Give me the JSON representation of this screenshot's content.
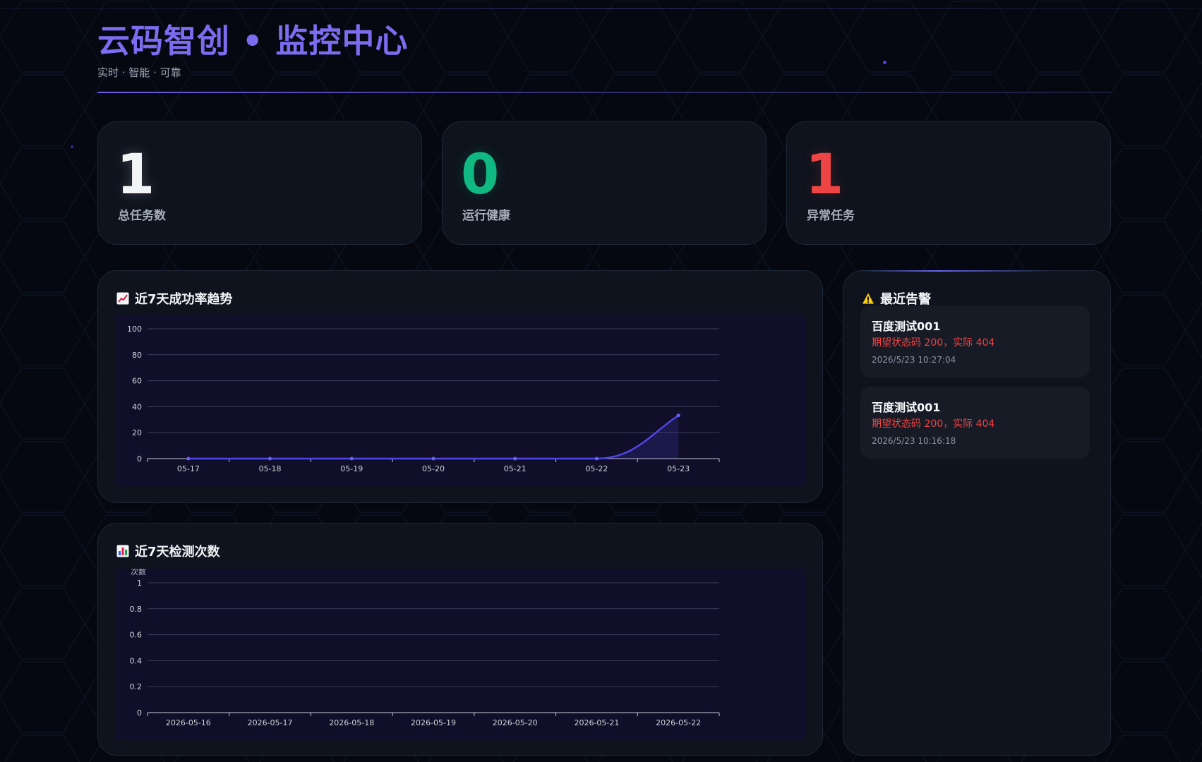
{
  "header": {
    "title": "云码智创 • 监控中心",
    "subtitle": "实时 · 智能 · 可靠"
  },
  "stats": [
    {
      "value": "1",
      "label": "总任务数",
      "color": "#f3f4f6"
    },
    {
      "value": "0",
      "label": "运行健康",
      "color": "#10b981"
    },
    {
      "value": "1",
      "label": "异常任务",
      "color": "#ef4444"
    }
  ],
  "panels": {
    "trend_title": "近7天成功率趋势",
    "trend_icon": "chart-increasing-icon",
    "count_title": "近7天检测次数",
    "count_icon": "bar-chart-icon",
    "alerts_title": "最近告警",
    "alerts_icon": "warning-icon"
  },
  "alerts": [
    {
      "title": "百度测试001",
      "message": "期望状态码 200，实际 404",
      "time": "2026/5/23 10:27:04"
    },
    {
      "title": "百度测试001",
      "message": "期望状态码 200，实际 404",
      "time": "2026/5/23 10:16:18"
    }
  ],
  "chart_data": [
    {
      "type": "area",
      "title": "近7天成功率趋势",
      "categories": [
        "05-17",
        "05-18",
        "05-19",
        "05-20",
        "05-21",
        "05-22",
        "05-23"
      ],
      "values": [
        0,
        0,
        0,
        0,
        0,
        0,
        33.3
      ],
      "ylim": [
        0,
        100
      ],
      "yticks": [
        0,
        20,
        40,
        60,
        80,
        100
      ],
      "color": "#4f46e5",
      "grid": true
    },
    {
      "type": "bar",
      "title": "近7天检测次数",
      "ylabel": "次数",
      "categories": [
        "2026-05-16",
        "2026-05-17",
        "2026-05-18",
        "2026-05-19",
        "2026-05-20",
        "2026-05-21",
        "2026-05-22"
      ],
      "values": [
        0,
        0,
        0,
        0,
        0,
        0,
        0
      ],
      "ylim": [
        0,
        1
      ],
      "yticks": [
        "0",
        "0.2",
        "0.4",
        "0.6",
        "0.8",
        "1"
      ],
      "color": "#4f46e5",
      "grid": true
    }
  ]
}
